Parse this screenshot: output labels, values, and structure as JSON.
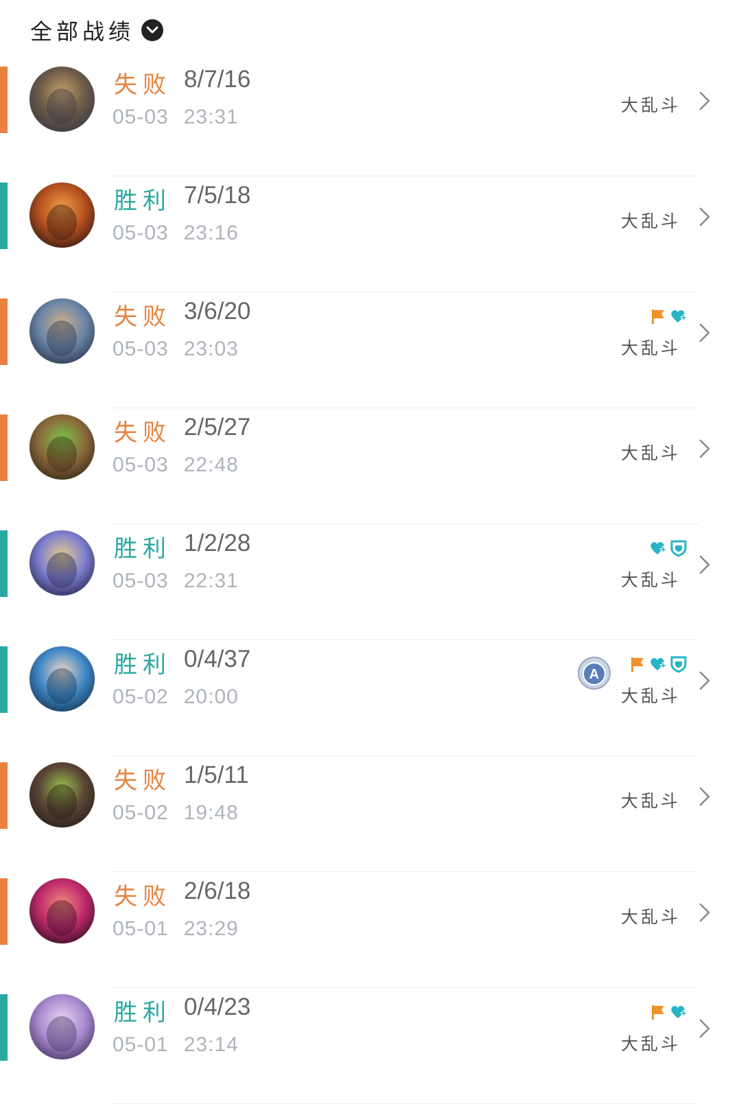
{
  "header": {
    "title": "全部战绩",
    "icon": "chevron-down-circle-icon"
  },
  "colors": {
    "loss": "#e8823f",
    "win": "#2aa8a2",
    "badge_orange": "#f0922a",
    "badge_teal": "#25b5c6"
  },
  "matches": [
    {
      "result": "失败",
      "outcome": "loss",
      "kda": "8/7/16",
      "date": "05-03",
      "time": "23:31",
      "mode": "大乱斗",
      "badges": [],
      "rank_badge": ""
    },
    {
      "result": "胜利",
      "outcome": "win",
      "kda": "7/5/18",
      "date": "05-03",
      "time": "23:16",
      "mode": "大乱斗",
      "badges": [],
      "rank_badge": ""
    },
    {
      "result": "失败",
      "outcome": "loss",
      "kda": "3/6/20",
      "date": "05-03",
      "time": "23:03",
      "mode": "大乱斗",
      "badges": [
        "flag-icon",
        "heal-icon"
      ],
      "rank_badge": ""
    },
    {
      "result": "失败",
      "outcome": "loss",
      "kda": "2/5/27",
      "date": "05-03",
      "time": "22:48",
      "mode": "大乱斗",
      "badges": [],
      "rank_badge": ""
    },
    {
      "result": "胜利",
      "outcome": "win",
      "kda": "1/2/28",
      "date": "05-03",
      "time": "22:31",
      "mode": "大乱斗",
      "badges": [
        "heal-icon",
        "shield-icon"
      ],
      "rank_badge": ""
    },
    {
      "result": "胜利",
      "outcome": "win",
      "kda": "0/4/37",
      "date": "05-02",
      "time": "20:00",
      "mode": "大乱斗",
      "badges": [
        "flag-icon",
        "heal-icon",
        "shield-icon"
      ],
      "rank_badge": "A"
    },
    {
      "result": "失败",
      "outcome": "loss",
      "kda": "1/5/11",
      "date": "05-02",
      "time": "19:48",
      "mode": "大乱斗",
      "badges": [],
      "rank_badge": ""
    },
    {
      "result": "失败",
      "outcome": "loss",
      "kda": "2/6/18",
      "date": "05-01",
      "time": "23:29",
      "mode": "大乱斗",
      "badges": [],
      "rank_badge": ""
    },
    {
      "result": "胜利",
      "outcome": "win",
      "kda": "0/4/23",
      "date": "05-01",
      "time": "23:14",
      "mode": "大乱斗",
      "badges": [
        "flag-icon",
        "heal-icon"
      ],
      "rank_badge": ""
    }
  ]
}
